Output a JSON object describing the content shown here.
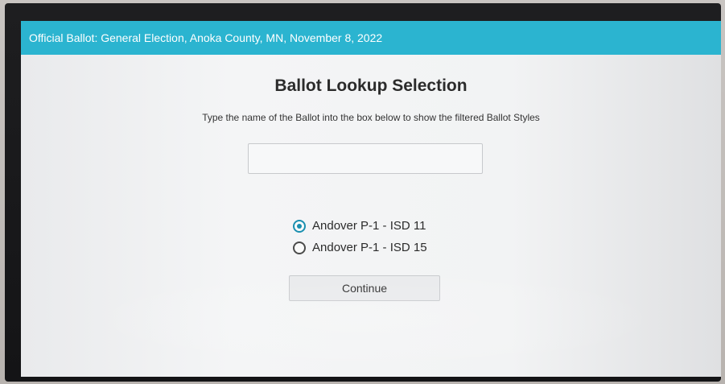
{
  "header": {
    "title": "Official Ballot: General Election, Anoka County, MN, November 8, 2022"
  },
  "main": {
    "title": "Ballot Lookup Selection",
    "instructions": "Type the name of the Ballot into the box below to show the filtered Ballot Styles",
    "search": {
      "value": "",
      "placeholder": ""
    },
    "ballot_styles": [
      {
        "label": "Andover P-1 - ISD 11",
        "selected": true
      },
      {
        "label": "Andover P-1 - ISD 15",
        "selected": false
      }
    ],
    "continue_label": "Continue"
  },
  "colors": {
    "header_bar": "#2bb4d0",
    "radio_selected": "#1a8fb0"
  }
}
